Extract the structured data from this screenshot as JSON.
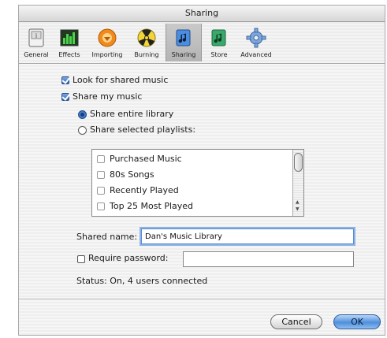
{
  "window": {
    "title": "Sharing"
  },
  "toolbar": {
    "items": [
      {
        "label": "General",
        "icon": "general-icon"
      },
      {
        "label": "Effects",
        "icon": "equalizer-icon"
      },
      {
        "label": "Importing",
        "icon": "importing-icon"
      },
      {
        "label": "Burning",
        "icon": "burning-icon"
      },
      {
        "label": "Sharing",
        "icon": "sharing-icon",
        "selected": true
      },
      {
        "label": "Store",
        "icon": "store-icon"
      },
      {
        "label": "Advanced",
        "icon": "gear-icon"
      }
    ]
  },
  "options": {
    "look_for_shared": {
      "label": "Look for shared music",
      "checked": true
    },
    "share_my_music": {
      "label": "Share my music",
      "checked": true
    },
    "share_entire": {
      "label": "Share entire library",
      "selected": true
    },
    "share_selected": {
      "label": "Share selected playlists:",
      "selected": false
    }
  },
  "playlists": [
    {
      "name": "Purchased Music",
      "checked": false
    },
    {
      "name": "80s Songs",
      "checked": false
    },
    {
      "name": "Recently Played",
      "checked": false
    },
    {
      "name": "Top 25 Most Played",
      "checked": false
    }
  ],
  "shared_name": {
    "label": "Shared name:",
    "value": "Dan's Music Library"
  },
  "password": {
    "label": "Require password:",
    "value": ""
  },
  "status": {
    "text": "Status: On, 4 users connected"
  },
  "buttons": {
    "cancel": "Cancel",
    "ok": "OK"
  },
  "colors": {
    "accent": "#4f8fdc",
    "selected_tab": "#b4b4b4"
  }
}
